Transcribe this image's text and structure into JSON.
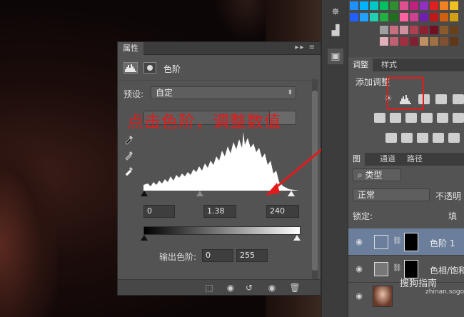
{
  "properties_panel": {
    "tab_title": "属性",
    "layer_type": "色阶",
    "preset_label": "预设:",
    "preset_value": "自定",
    "input_black": "0",
    "input_gamma": "1.38",
    "input_white": "240",
    "output_label": "输出色阶:",
    "output_black": "0",
    "output_white": "255",
    "auto_label": "自"
  },
  "annotation": {
    "text": "点击色阶，调整数值",
    "color": "#e21b1b"
  },
  "adjustments_panel": {
    "tab_active": "调整",
    "tab_other": "样式",
    "title": "添加调整"
  },
  "layers_panel": {
    "tab_active": "图",
    "tab_channels": "通道",
    "tab_paths": "路径",
    "filter_label": "类型",
    "blend_mode": "正常",
    "opacity_label": "不透明",
    "lock_label": "锁定:",
    "fill_label": "填",
    "layers": [
      {
        "name": "色阶 1",
        "selected": true
      },
      {
        "name": "色相/饱和",
        "selected": false
      },
      {
        "name": "",
        "selected": false
      }
    ]
  },
  "watermark": {
    "text": "搜狗指南",
    "url": "zhinan.sogou.com"
  },
  "colors": {
    "accent_red": "#e21b1b",
    "selection_blue": "#6b7f9c",
    "panel_bg": "#535353"
  }
}
